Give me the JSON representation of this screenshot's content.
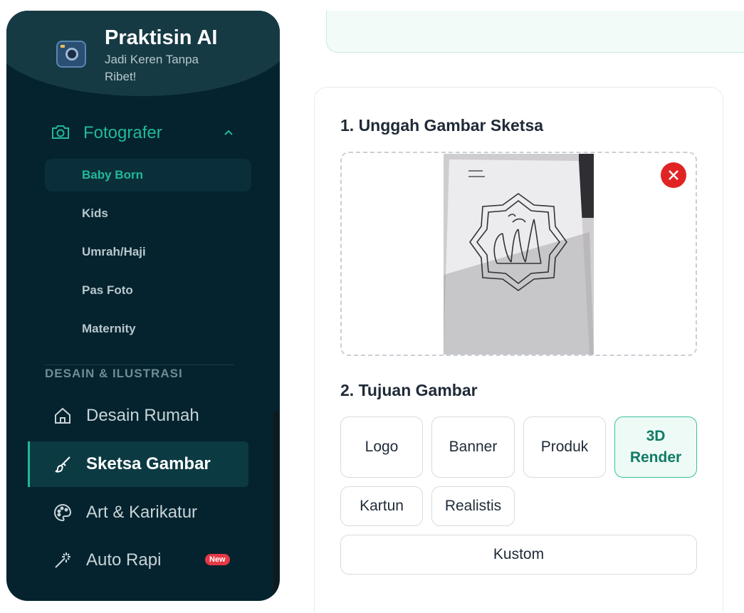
{
  "brand": {
    "title": "Praktisin AI",
    "subtitle": "Jadi Keren Tanpa Ribet!"
  },
  "sidebar": {
    "section": {
      "label": "Fotografer",
      "icon": "camera-icon",
      "expanded": true
    },
    "sub_items": [
      {
        "label": "Baby Born",
        "active": true
      },
      {
        "label": "Kids"
      },
      {
        "label": "Umrah/Haji"
      },
      {
        "label": "Pas Foto"
      },
      {
        "label": "Maternity"
      }
    ],
    "category": "DESAIN & ILUSTRASI",
    "items": [
      {
        "label": "Desain Rumah",
        "icon": "home-icon"
      },
      {
        "label": "Sketsa Gambar",
        "icon": "brush-icon",
        "active": true
      },
      {
        "label": "Art & Karikatur",
        "icon": "palette-icon"
      },
      {
        "label": "Auto Rapi",
        "icon": "magic-wand-icon",
        "badge": "New"
      }
    ]
  },
  "main": {
    "step1": {
      "title": "1. Unggah Gambar Sketsa"
    },
    "step2": {
      "title": "2. Tujuan Gambar",
      "options": [
        "Logo",
        "Banner",
        "Produk",
        "3D Render",
        "Kartun",
        "Realistis",
        "Kustom"
      ],
      "selected": "3D Render"
    }
  },
  "colors": {
    "accent": "#22b89a",
    "sidebar_bg": "#04232e",
    "danger": "#e02424"
  }
}
